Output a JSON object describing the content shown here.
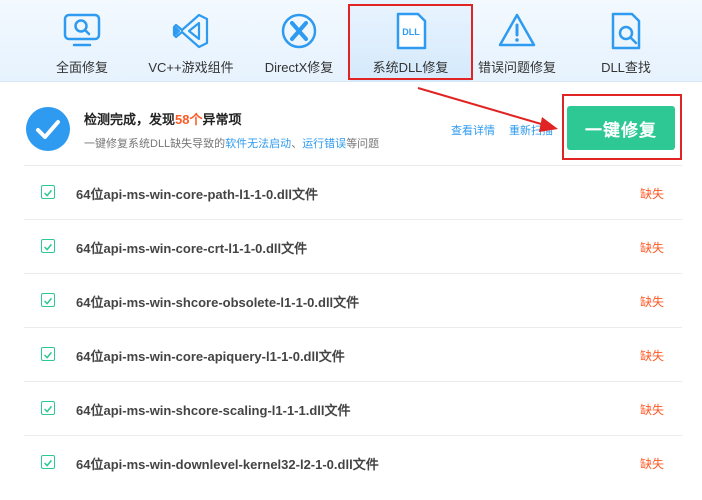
{
  "toolbar": {
    "items": [
      {
        "label": "全面修复",
        "icon": "monitor-search-icon"
      },
      {
        "label": "VC++游戏组件",
        "icon": "visual-studio-icon"
      },
      {
        "label": "DirectX修复",
        "icon": "directx-icon"
      },
      {
        "label": "系统DLL修复",
        "icon": "dll-file-icon",
        "active": true,
        "icon_text": "DLL"
      },
      {
        "label": "错误问题修复",
        "icon": "warning-triangle-icon"
      },
      {
        "label": "DLL查找",
        "icon": "file-search-icon"
      }
    ]
  },
  "summary": {
    "title_prefix": "检测完成，发现",
    "title_count": "58个",
    "title_suffix": "异常项",
    "sub_prefix": "一键修复系统DLL缺失导致的",
    "sub_link1": "软件无法启动",
    "sub_sep": "、",
    "sub_link2": "运行错误",
    "sub_suffix": "等问题",
    "view_details": "查看详情",
    "rescan": "重新扫描",
    "fix_button": "一键修复"
  },
  "rows": [
    {
      "name": "64位api-ms-win-core-path-l1-1-0.dll文件",
      "status": "缺失"
    },
    {
      "name": "64位api-ms-win-core-crt-l1-1-0.dll文件",
      "status": "缺失"
    },
    {
      "name": "64位api-ms-win-shcore-obsolete-l1-1-0.dll文件",
      "status": "缺失"
    },
    {
      "name": "64位api-ms-win-core-apiquery-l1-1-0.dll文件",
      "status": "缺失"
    },
    {
      "name": "64位api-ms-win-shcore-scaling-l1-1-1.dll文件",
      "status": "缺失"
    },
    {
      "name": "64位api-ms-win-downlevel-kernel32-l2-1-0.dll文件",
      "status": "缺失"
    }
  ],
  "colors": {
    "accent_blue": "#2e9bf0",
    "fix_green": "#2ec895",
    "warning_orange": "#ff5a26",
    "annotation_red": "#e02424"
  }
}
